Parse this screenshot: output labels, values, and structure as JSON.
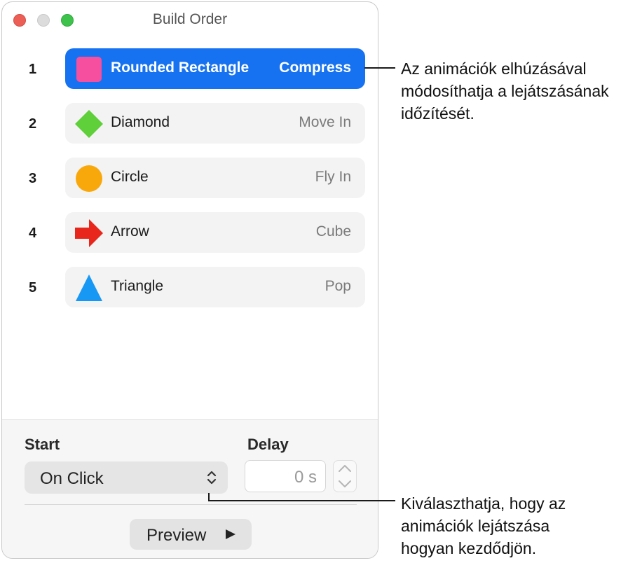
{
  "window": {
    "title": "Build Order"
  },
  "build_list": [
    {
      "number": "1",
      "name": "Rounded Rectangle",
      "effect": "Compress",
      "shape_icon": "rounded-square-icon",
      "color": "#f64fa0",
      "selected": true
    },
    {
      "number": "2",
      "name": "Diamond",
      "effect": "Move In",
      "shape_icon": "diamond-icon",
      "color": "#5fd03a",
      "selected": false
    },
    {
      "number": "3",
      "name": "Circle",
      "effect": "Fly In",
      "shape_icon": "circle-icon",
      "color": "#f9a80b",
      "selected": false
    },
    {
      "number": "4",
      "name": "Arrow",
      "effect": "Cube",
      "shape_icon": "arrow-icon",
      "color": "#e8261c",
      "selected": false
    },
    {
      "number": "5",
      "name": "Triangle",
      "effect": "Pop",
      "shape_icon": "triangle-icon",
      "color": "#1898f5",
      "selected": false
    }
  ],
  "panel": {
    "start_label": "Start",
    "start_value": "On Click",
    "delay_label": "Delay",
    "delay_value": "0 s",
    "preview_label": "Preview"
  },
  "callouts": {
    "top": [
      "Az animációk elhúzásával",
      "módosíthatja a lejátszásának",
      "időzítését."
    ],
    "bottom": [
      "Kiválaszthatja, hogy az",
      "animációk lejátszása",
      "hogyan kezdődjön."
    ]
  },
  "colors": {
    "selection_blue": "#1672f0",
    "row_background": "#f3f3f3"
  }
}
